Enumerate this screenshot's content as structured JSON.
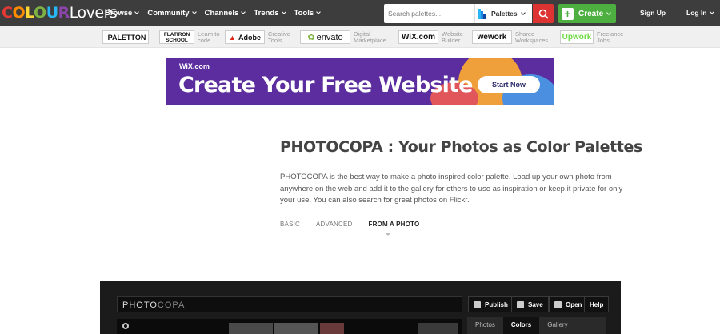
{
  "header": {
    "logo": {
      "letters": [
        {
          "ch": "C",
          "color": "#e53935"
        },
        {
          "ch": "O",
          "color": "#fb8c00"
        },
        {
          "ch": "L",
          "color": "#fdd835"
        },
        {
          "ch": "O",
          "color": "#7cb342"
        },
        {
          "ch": "U",
          "color": "#29b6f6"
        },
        {
          "ch": "R",
          "color": "#8e44ad"
        }
      ],
      "suffix": "Lovers"
    },
    "nav": [
      {
        "label": "Browse",
        "name": "nav-browse"
      },
      {
        "label": "Community",
        "name": "nav-community"
      },
      {
        "label": "Channels",
        "name": "nav-channels"
      },
      {
        "label": "Trends",
        "name": "nav-trends"
      },
      {
        "label": "Tools",
        "name": "nav-tools"
      }
    ],
    "search_placeholder": "Search palettes...",
    "search_type": "Palettes",
    "create_label": "Create",
    "signup_label": "Sign Up",
    "login_label": "Log In"
  },
  "sponsors": [
    {
      "logo": "PALETTON",
      "desc": ""
    },
    {
      "logo": "FLATIRON SCHOOL",
      "desc": "Learn to code"
    },
    {
      "logo": "Adobe",
      "desc": "Creative Tools"
    },
    {
      "logo": "envato",
      "desc": "Digital Marketplace"
    },
    {
      "logo": "WiX.com",
      "desc": "Website Builder"
    },
    {
      "logo": "wework",
      "desc": "Shared Workspaces"
    },
    {
      "logo": "Upwork",
      "desc": "Freelance Jobs"
    }
  ],
  "ad": {
    "brand": "WiX.com",
    "headline": "Create Your Free Website",
    "cta": "Start Now"
  },
  "main": {
    "title": "PHOTOCOPA : Your Photos as Color Palettes",
    "intro": "PHOTOCOPA is the best way to make a photo inspired color palette. Load up your own photo from anywhere on the web and add it to the gallery for others to use as inspiration or keep it private for only your use. You can also search for great photos on Flickr.",
    "tabs": [
      "BASIC",
      "ADVANCED",
      "FROM A PHOTO"
    ],
    "active_tab": "FROM A PHOTO"
  },
  "photocopa": {
    "title_a": "PHOTO",
    "title_b": "COPA",
    "buttons": [
      "Publish",
      "Save",
      "Open",
      "Help"
    ],
    "side_tabs": [
      "Photos",
      "Colors",
      "Gallery"
    ],
    "active_side_tab": "Colors"
  },
  "colors": {
    "topbar": "#3d3d3d",
    "search_red": "#dd3333",
    "create_green": "#4caf3f",
    "ad_purple": "#5b2d9e"
  }
}
